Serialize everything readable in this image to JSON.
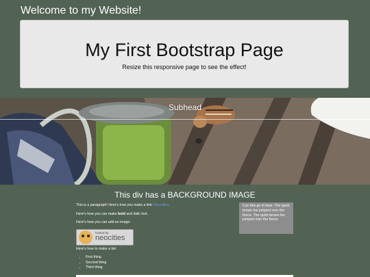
{
  "site": {
    "title": "Welcome to my Website!"
  },
  "jumbotron": {
    "heading": "My First Bootstrap Page",
    "subtext": "Resize this responsive page to see the effect!"
  },
  "banner": {
    "subhead": "Subhead"
  },
  "section": {
    "title": "This div has a BACKGROUND IMAGE"
  },
  "content": {
    "para1_text": "This is a paragraph! Here's how you make a link: ",
    "para1_link": "Neocities",
    "para1_end": ".",
    "para2_a": "Here's how you can make ",
    "para2_bold": "bold",
    "para2_b": " and ",
    "para2_italic": "italic",
    "para2_c": " text.",
    "para3": "Here's how you can add an image:",
    "badge_small": "hosted by",
    "badge_big": "neocities",
    "para4": "Here's how to make a list:",
    "list": [
      "First thing",
      "Second thing",
      "Third thing"
    ]
  },
  "sidebox": {
    "text": "Can this go in here. The quick brown fox jumped over the fence. The quick brown fox jumped over the fence."
  },
  "colors": {
    "background": "#526253",
    "jumbotron": "#e9e9e9",
    "sidebox": "#8d8d8d",
    "link": "#5aa0e6"
  }
}
